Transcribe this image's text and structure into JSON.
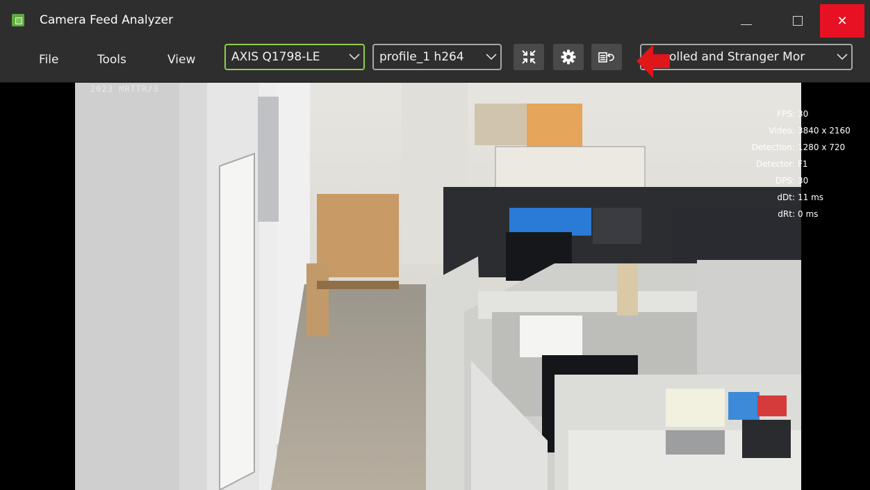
{
  "window": {
    "title": "Camera Feed Analyzer",
    "close_label": "✕"
  },
  "menu": {
    "file": "File",
    "tools": "Tools",
    "view": "View"
  },
  "toolbar": {
    "camera_select": "AXIS Q1798-LE",
    "stream_select": "profile_1 h264",
    "profile_select": "olled and Stranger Mor"
  },
  "overlay": {
    "timestamp": "2023 MRTTR/3",
    "stats": [
      {
        "key": "FPS:",
        "value": "30"
      },
      {
        "key": "Video:",
        "value": "3840 x 2160"
      },
      {
        "key": "Detection:",
        "value": "1280 x 720"
      },
      {
        "key": "Detector:",
        "value": "F1"
      },
      {
        "key": "DPS:",
        "value": "30"
      },
      {
        "key": "dDt:",
        "value": "11 ms"
      },
      {
        "key": "dRt:",
        "value": "0 ms"
      }
    ]
  },
  "colors": {
    "accent_green": "#8fd14a",
    "close_red": "#e81123",
    "annotation_red": "#e0161a"
  },
  "icons": {
    "collapse": "collapse-arrows-icon",
    "settings": "gear-icon",
    "swap": "swap-return-icon",
    "annotation": "red-arrow-annotation"
  }
}
